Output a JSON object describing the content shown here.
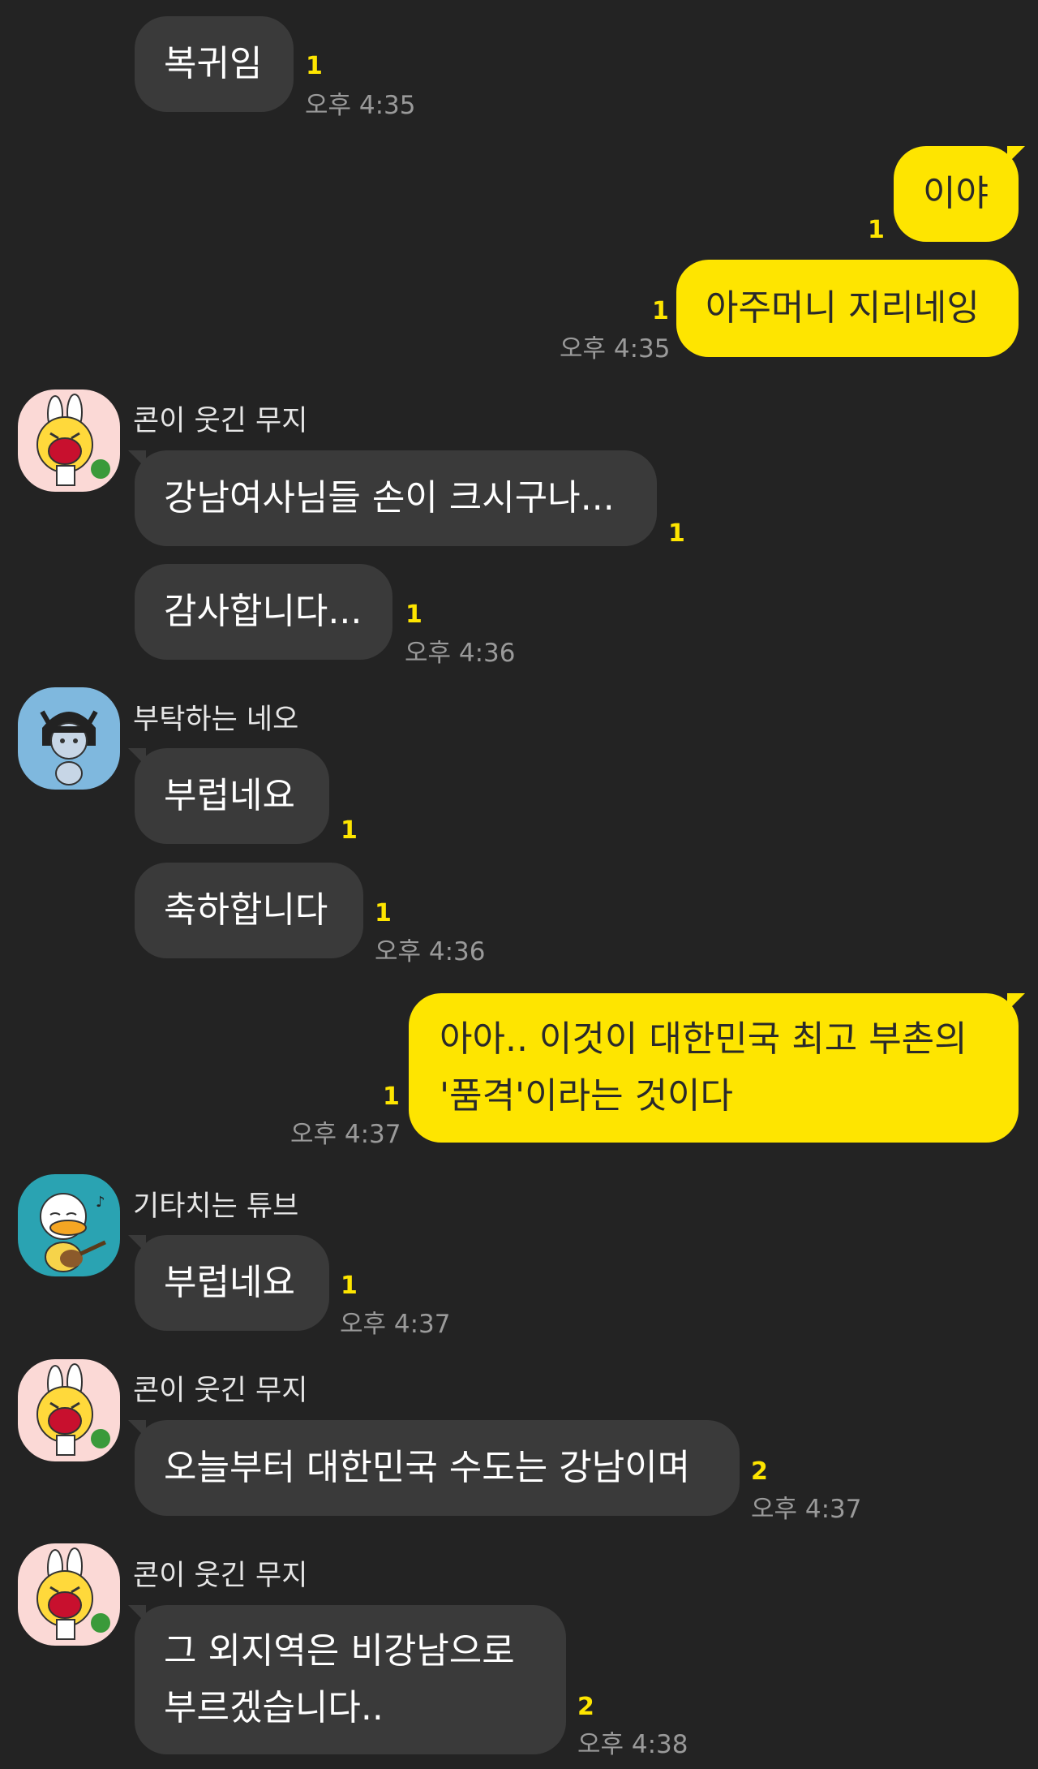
{
  "colors": {
    "background": "#232323",
    "incoming_bubble": "#3a3a3a",
    "outgoing_bubble": "#fee500",
    "unread_count": "#fee500",
    "timestamp": "#9a9a9a"
  },
  "messages": [
    {
      "text": "복귀임",
      "unread": "1",
      "time": "오후 4:35"
    },
    {
      "text": "이야",
      "unread": "1"
    },
    {
      "text": "아주머니 지리네잉",
      "unread": "1",
      "time": "오후 4:35"
    },
    {
      "sender": "콘이 웃긴 무지",
      "avatar_icon": "muzi-laughing-avatar-icon",
      "text": "강남여사님들 손이 크시구나...",
      "unread": "1"
    },
    {
      "text": "감사합니다...",
      "unread": "1",
      "time": "오후 4:36"
    },
    {
      "sender": "부탁하는 네오",
      "avatar_icon": "neo-pleading-avatar-icon",
      "text": "부럽네요",
      "unread": "1"
    },
    {
      "text": "축하합니다",
      "unread": "1",
      "time": "오후 4:36"
    },
    {
      "text_line1": "아아.. 이것이 대한민국 최고 부촌의",
      "text_line2": "'품격'이라는 것이다",
      "unread": "1",
      "time": "오후 4:37"
    },
    {
      "sender": "기타치는 튜브",
      "avatar_icon": "tube-guitar-avatar-icon",
      "text": "부럽네요",
      "unread": "1",
      "time": "오후 4:37"
    },
    {
      "sender": "콘이 웃긴 무지",
      "avatar_icon": "muzi-laughing-avatar-icon",
      "text": "오늘부터 대한민국 수도는 강남이며",
      "unread": "2",
      "time": "오후 4:37"
    },
    {
      "sender": "콘이 웃긴 무지",
      "avatar_icon": "muzi-laughing-avatar-icon",
      "text_line1": "그 외지역은 비강남으로",
      "text_line2": "부르겠습니다..",
      "unread": "2",
      "time": "오후 4:38"
    }
  ]
}
